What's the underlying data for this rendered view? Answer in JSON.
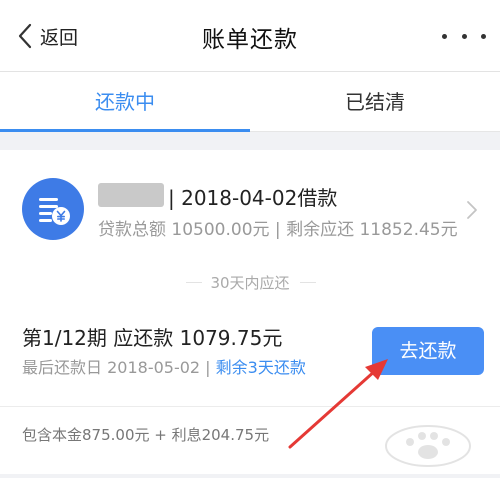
{
  "nav": {
    "back_label": "返回",
    "title": "账单还款"
  },
  "tabs": [
    {
      "label": "还款中",
      "active": true
    },
    {
      "label": "已结清",
      "active": false
    }
  ],
  "loan": {
    "name_and_date": "| 2018-04-02借款",
    "amount_label": "贷款总额",
    "amount": "10500.00元",
    "remaining_label": "剩余应还",
    "remaining": "11852.45元"
  },
  "due_section": {
    "label": "30天内应还"
  },
  "installment": {
    "title": "第1/12期 应还款 1079.75元",
    "last_day_label": "最后还款日",
    "last_day": "2018-05-02",
    "remaining_days": "剩余3天还款",
    "pay_button": "去还款",
    "breakdown": "包含本金875.00元 + 利息204.75元"
  },
  "colors": {
    "accent": "#3b8df0",
    "button": "#4a8ff5",
    "icon_bg": "#3e7be6",
    "annotation_arrow": "#e53935"
  },
  "icons": {
    "back": "chevron-left-icon",
    "more": "more-dots-icon",
    "loan": "bill-yen-icon",
    "row": "chevron-right-icon"
  }
}
